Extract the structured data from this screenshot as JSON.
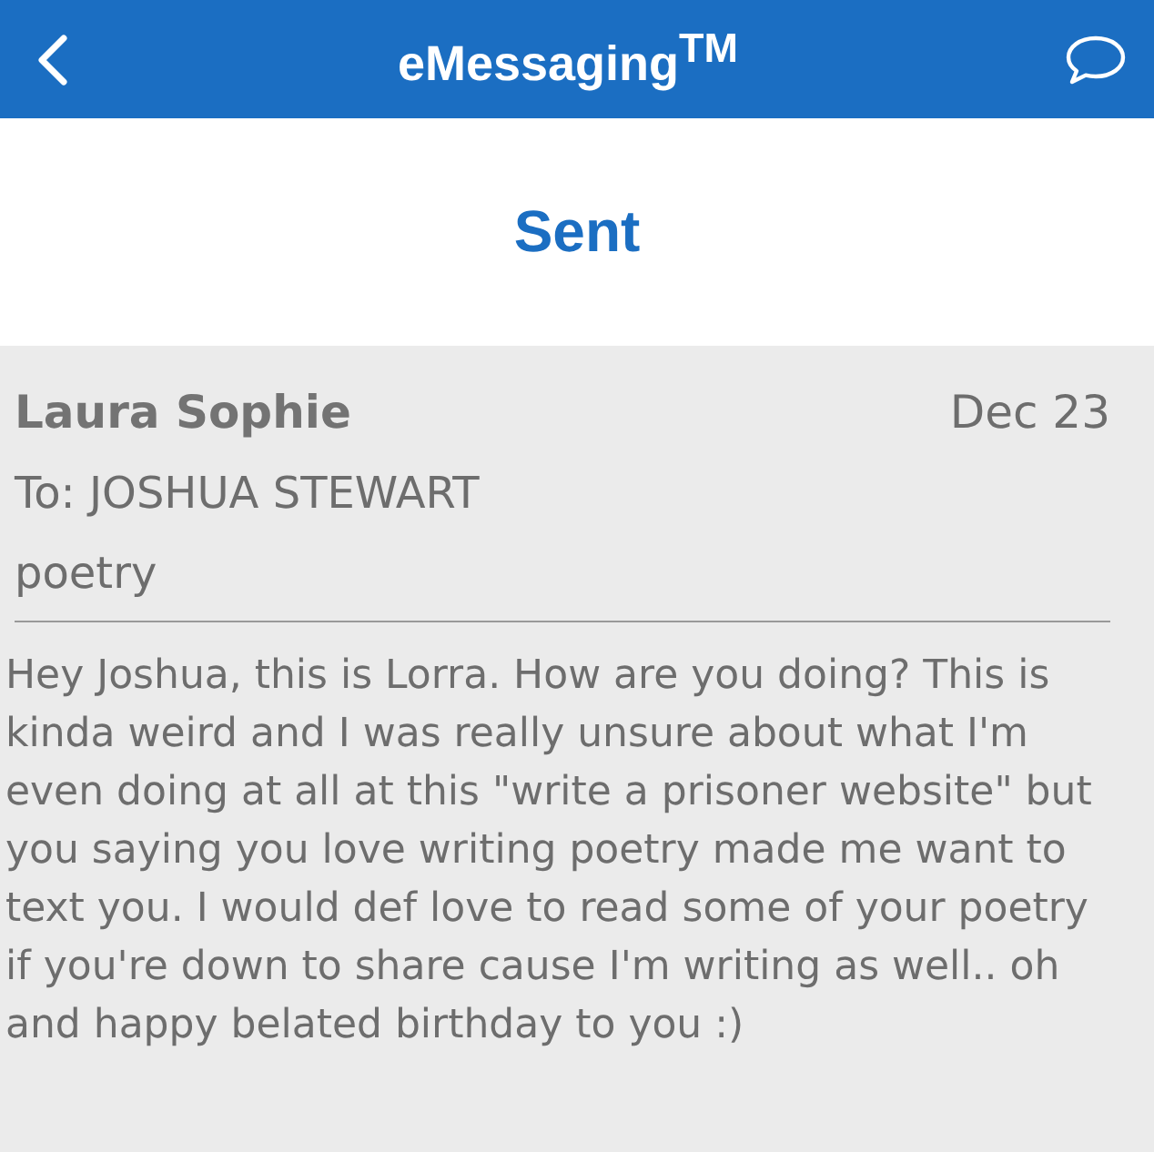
{
  "header": {
    "title": "eMessaging$^{TM}$"
  },
  "folder": {
    "title": "Sent"
  },
  "message": {
    "sender": "Laura Sophie",
    "date": "Dec 23",
    "to": "To: JOSHUA STEWART",
    "subject": "poetry",
    "body": "Hey Joshua, this is Lorra. How are you doing? This is kinda weird and I was really unsure about what I'm even doing at all at this \"write a prisoner website\" but you saying you love writing poetry made me want to text you. I would def love to read some of your poetry if you're down to share cause I'm writing as well.. oh and happy belated birthday to you :)"
  }
}
